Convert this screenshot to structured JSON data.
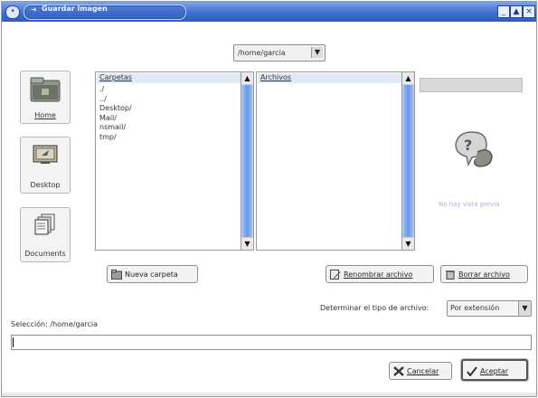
{
  "window": {
    "title": "Guardar imagen",
    "controls": [
      "minimize-icon",
      "maximize-icon",
      "close-icon"
    ],
    "titlebar_color": "#3f6fcf"
  },
  "path_selector": {
    "value": "/home/garcia"
  },
  "places": [
    {
      "label": "Home",
      "icon": "home-folder-icon"
    },
    {
      "label": "Desktop",
      "icon": "desktop-icon"
    },
    {
      "label": "Documents",
      "icon": "documents-icon"
    }
  ],
  "folders_pane": {
    "header": "Carpetas",
    "items": [
      "./",
      "../",
      "Desktop/",
      "Mail/",
      "nsmail/",
      "tmp/"
    ]
  },
  "files_pane": {
    "header": "Archivos",
    "items": []
  },
  "preview": {
    "message": "No hay vista previa",
    "icon": "question-mark-icon"
  },
  "buttons": {
    "new_folder": "Nueva carpeta",
    "rename_file": "Renombrar archivo",
    "delete_file": "Borrar archivo",
    "cancel": "Cancelar",
    "accept": "Aceptar"
  },
  "file_type": {
    "label": "Determinar el tipo de archivo:",
    "value": "Por extensión"
  },
  "selection": {
    "label": "Selección: /home/garcia",
    "value": ""
  }
}
